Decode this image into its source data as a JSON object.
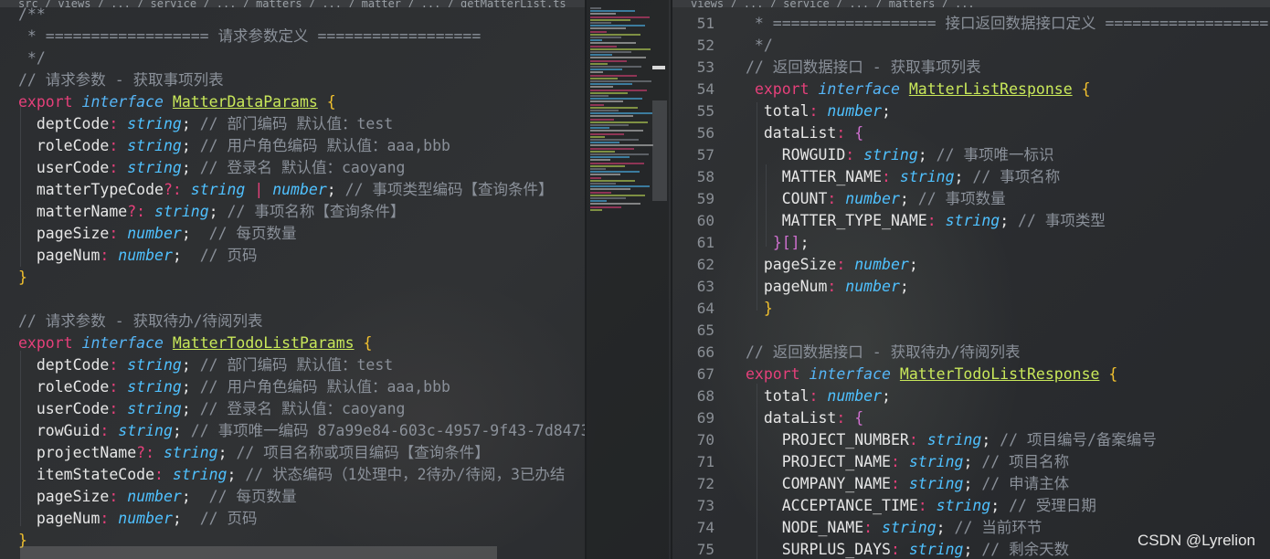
{
  "tabs": {
    "left_path": "src / views / ... / service / ... / matters / ... / matter / ... / getMatterList.ts",
    "right_path": "views / ... / service / ... / matters / ..."
  },
  "left": {
    "lines": [
      [
        [
          "cmt",
          "/**"
        ]
      ],
      [
        [
          "cmt",
          " * ================== 请求参数定义 =================="
        ]
      ],
      [
        [
          "cmt",
          " */"
        ]
      ],
      [
        [
          "cmt",
          "// 请求参数 - 获取事项列表"
        ]
      ],
      [
        [
          "kw",
          "export"
        ],
        [
          "punc",
          " "
        ],
        [
          "iface",
          "interface"
        ],
        [
          "punc",
          " "
        ],
        [
          "cls",
          "MatterDataParams"
        ],
        [
          "punc",
          " "
        ],
        [
          "brace",
          "{"
        ]
      ],
      [
        [
          "punc",
          "  "
        ],
        [
          "prop",
          "deptCode"
        ],
        [
          "opt",
          ":"
        ],
        [
          "punc",
          " "
        ],
        [
          "type",
          "string"
        ],
        [
          "punc",
          ";"
        ],
        [
          "cmt",
          " // 部门编码 默认值：test"
        ]
      ],
      [
        [
          "punc",
          "  "
        ],
        [
          "prop",
          "roleCode"
        ],
        [
          "opt",
          ":"
        ],
        [
          "punc",
          " "
        ],
        [
          "type",
          "string"
        ],
        [
          "punc",
          ";"
        ],
        [
          "cmt",
          " // 用户角色编码 默认值：aaa,bbb"
        ]
      ],
      [
        [
          "punc",
          "  "
        ],
        [
          "prop",
          "userCode"
        ],
        [
          "opt",
          ":"
        ],
        [
          "punc",
          " "
        ],
        [
          "type",
          "string"
        ],
        [
          "punc",
          ";"
        ],
        [
          "cmt",
          " // 登录名 默认值：caoyang"
        ]
      ],
      [
        [
          "punc",
          "  "
        ],
        [
          "prop",
          "matterTypeCode"
        ],
        [
          "opt",
          "?:"
        ],
        [
          "punc",
          " "
        ],
        [
          "type",
          "string"
        ],
        [
          "punc",
          " "
        ],
        [
          "kw",
          "|"
        ],
        [
          "punc",
          " "
        ],
        [
          "type",
          "number"
        ],
        [
          "punc",
          ";"
        ],
        [
          "cmt",
          " // 事项类型编码【查询条件】"
        ]
      ],
      [
        [
          "punc",
          "  "
        ],
        [
          "prop",
          "matterName"
        ],
        [
          "opt",
          "?:"
        ],
        [
          "punc",
          " "
        ],
        [
          "type",
          "string"
        ],
        [
          "punc",
          ";"
        ],
        [
          "cmt",
          " // 事项名称【查询条件】"
        ]
      ],
      [
        [
          "punc",
          "  "
        ],
        [
          "prop",
          "pageSize"
        ],
        [
          "opt",
          ":"
        ],
        [
          "punc",
          " "
        ],
        [
          "type",
          "number"
        ],
        [
          "punc",
          ";"
        ],
        [
          "cmt",
          "  // 每页数量"
        ]
      ],
      [
        [
          "punc",
          "  "
        ],
        [
          "prop",
          "pageNum"
        ],
        [
          "opt",
          ":"
        ],
        [
          "punc",
          " "
        ],
        [
          "type",
          "number"
        ],
        [
          "punc",
          ";"
        ],
        [
          "cmt",
          "  // 页码"
        ]
      ],
      [
        [
          "brace",
          "}"
        ]
      ],
      [],
      [
        [
          "cmt",
          "// 请求参数 - 获取待办/待阅列表"
        ]
      ],
      [
        [
          "kw",
          "export"
        ],
        [
          "punc",
          " "
        ],
        [
          "iface",
          "interface"
        ],
        [
          "punc",
          " "
        ],
        [
          "cls",
          "MatterTodoListParams"
        ],
        [
          "punc",
          " "
        ],
        [
          "brace",
          "{"
        ]
      ],
      [
        [
          "punc",
          "  "
        ],
        [
          "prop",
          "deptCode"
        ],
        [
          "opt",
          ":"
        ],
        [
          "punc",
          " "
        ],
        [
          "type",
          "string"
        ],
        [
          "punc",
          ";"
        ],
        [
          "cmt",
          " // 部门编码 默认值：test"
        ]
      ],
      [
        [
          "punc",
          "  "
        ],
        [
          "prop",
          "roleCode"
        ],
        [
          "opt",
          ":"
        ],
        [
          "punc",
          " "
        ],
        [
          "type",
          "string"
        ],
        [
          "punc",
          ";"
        ],
        [
          "cmt",
          " // 用户角色编码 默认值：aaa,bbb"
        ]
      ],
      [
        [
          "punc",
          "  "
        ],
        [
          "prop",
          "userCode"
        ],
        [
          "opt",
          ":"
        ],
        [
          "punc",
          " "
        ],
        [
          "type",
          "string"
        ],
        [
          "punc",
          ";"
        ],
        [
          "cmt",
          " // 登录名 默认值：caoyang"
        ]
      ],
      [
        [
          "punc",
          "  "
        ],
        [
          "prop",
          "rowGuid"
        ],
        [
          "opt",
          ":"
        ],
        [
          "punc",
          " "
        ],
        [
          "type",
          "string"
        ],
        [
          "punc",
          ";"
        ],
        [
          "cmt",
          " // 事项唯一编码 87a99e84-603c-4957-9f43-7d8473"
        ]
      ],
      [
        [
          "punc",
          "  "
        ],
        [
          "prop",
          "projectName"
        ],
        [
          "opt",
          "?:"
        ],
        [
          "punc",
          " "
        ],
        [
          "type",
          "string"
        ],
        [
          "punc",
          ";"
        ],
        [
          "cmt",
          " // 项目名称或项目编码【查询条件】"
        ]
      ],
      [
        [
          "punc",
          "  "
        ],
        [
          "prop",
          "itemStateCode"
        ],
        [
          "opt",
          ":"
        ],
        [
          "punc",
          " "
        ],
        [
          "type",
          "string"
        ],
        [
          "punc",
          ";"
        ],
        [
          "cmt",
          " // 状态编码（1处理中，2待办/待阅，3已办结"
        ]
      ],
      [
        [
          "punc",
          "  "
        ],
        [
          "prop",
          "pageSize"
        ],
        [
          "opt",
          ":"
        ],
        [
          "punc",
          " "
        ],
        [
          "type",
          "number"
        ],
        [
          "punc",
          ";"
        ],
        [
          "cmt",
          "  // 每页数量"
        ]
      ],
      [
        [
          "punc",
          "  "
        ],
        [
          "prop",
          "pageNum"
        ],
        [
          "opt",
          ":"
        ],
        [
          "punc",
          " "
        ],
        [
          "type",
          "number"
        ],
        [
          "punc",
          ";"
        ],
        [
          "cmt",
          "  // 页码"
        ]
      ],
      [
        [
          "brace",
          "}"
        ]
      ]
    ]
  },
  "right": {
    "numbers": [
      "51",
      "52",
      "53",
      "54",
      "55",
      "56",
      "57",
      "58",
      "59",
      "60",
      "61",
      "62",
      "63",
      "64",
      "65",
      "66",
      "67",
      "68",
      "69",
      "70",
      "71",
      "72",
      "73",
      "74",
      "75"
    ],
    "lines": [
      [
        [
          "cmt",
          " * ================== 接口返回数据接口定义 =================="
        ]
      ],
      [
        [
          "cmt",
          " */"
        ]
      ],
      [
        [
          "cmt",
          "// 返回数据接口 - 获取事项列表"
        ]
      ],
      [
        [
          "punc",
          " "
        ],
        [
          "kw",
          "export"
        ],
        [
          "punc",
          " "
        ],
        [
          "iface",
          "interface"
        ],
        [
          "punc",
          " "
        ],
        [
          "cls",
          "MatterListResponse"
        ],
        [
          "punc",
          " "
        ],
        [
          "brace",
          "{"
        ]
      ],
      [
        [
          "punc",
          "  "
        ],
        [
          "prop",
          "total"
        ],
        [
          "opt",
          ":"
        ],
        [
          "punc",
          " "
        ],
        [
          "type",
          "number"
        ],
        [
          "punc",
          ";"
        ]
      ],
      [
        [
          "punc",
          "  "
        ],
        [
          "prop",
          "dataList"
        ],
        [
          "opt",
          ":"
        ],
        [
          "punc",
          " "
        ],
        [
          "brace2",
          "{"
        ]
      ],
      [
        [
          "punc",
          "    "
        ],
        [
          "prop",
          "ROWGUID"
        ],
        [
          "opt",
          ":"
        ],
        [
          "punc",
          " "
        ],
        [
          "type",
          "string"
        ],
        [
          "punc",
          ";"
        ],
        [
          "cmt",
          " // 事项唯一标识"
        ]
      ],
      [
        [
          "punc",
          "    "
        ],
        [
          "prop",
          "MATTER_NAME"
        ],
        [
          "opt",
          ":"
        ],
        [
          "punc",
          " "
        ],
        [
          "type",
          "string"
        ],
        [
          "punc",
          ";"
        ],
        [
          "cmt",
          " // 事项名称"
        ]
      ],
      [
        [
          "punc",
          "    "
        ],
        [
          "prop",
          "COUNT"
        ],
        [
          "opt",
          ":"
        ],
        [
          "punc",
          " "
        ],
        [
          "type",
          "number"
        ],
        [
          "punc",
          ";"
        ],
        [
          "cmt",
          " // 事项数量"
        ]
      ],
      [
        [
          "punc",
          "    "
        ],
        [
          "prop",
          "MATTER_TYPE_NAME"
        ],
        [
          "opt",
          ":"
        ],
        [
          "punc",
          " "
        ],
        [
          "type",
          "string"
        ],
        [
          "punc",
          ";"
        ],
        [
          "cmt",
          " // 事项类型"
        ]
      ],
      [
        [
          "punc",
          "   "
        ],
        [
          "brace2",
          "}[]"
        ],
        [
          "punc",
          ";"
        ]
      ],
      [
        [
          "punc",
          "  "
        ],
        [
          "prop",
          "pageSize"
        ],
        [
          "opt",
          ":"
        ],
        [
          "punc",
          " "
        ],
        [
          "type",
          "number"
        ],
        [
          "punc",
          ";"
        ]
      ],
      [
        [
          "punc",
          "  "
        ],
        [
          "prop",
          "pageNum"
        ],
        [
          "opt",
          ":"
        ],
        [
          "punc",
          " "
        ],
        [
          "type",
          "number"
        ],
        [
          "punc",
          ";"
        ]
      ],
      [
        [
          "punc",
          "  "
        ],
        [
          "brace",
          "}"
        ]
      ],
      [],
      [
        [
          "cmt",
          "// 返回数据接口 - 获取待办/待阅列表"
        ]
      ],
      [
        [
          "kw",
          "export"
        ],
        [
          "punc",
          " "
        ],
        [
          "iface",
          "interface"
        ],
        [
          "punc",
          " "
        ],
        [
          "cls",
          "MatterTodoListResponse"
        ],
        [
          "punc",
          " "
        ],
        [
          "brace",
          "{"
        ]
      ],
      [
        [
          "punc",
          "  "
        ],
        [
          "prop",
          "total"
        ],
        [
          "opt",
          ":"
        ],
        [
          "punc",
          " "
        ],
        [
          "type",
          "number"
        ],
        [
          "punc",
          ";"
        ]
      ],
      [
        [
          "punc",
          "  "
        ],
        [
          "prop",
          "dataList"
        ],
        [
          "opt",
          ":"
        ],
        [
          "punc",
          " "
        ],
        [
          "brace2",
          "{"
        ]
      ],
      [
        [
          "punc",
          "    "
        ],
        [
          "prop",
          "PROJECT_NUMBER"
        ],
        [
          "opt",
          ":"
        ],
        [
          "punc",
          " "
        ],
        [
          "type",
          "string"
        ],
        [
          "punc",
          ";"
        ],
        [
          "cmt",
          " // 项目编号/备案编号"
        ]
      ],
      [
        [
          "punc",
          "    "
        ],
        [
          "prop",
          "PROJECT_NAME"
        ],
        [
          "opt",
          ":"
        ],
        [
          "punc",
          " "
        ],
        [
          "type",
          "string"
        ],
        [
          "punc",
          ";"
        ],
        [
          "cmt",
          " // 项目名称"
        ]
      ],
      [
        [
          "punc",
          "    "
        ],
        [
          "prop",
          "COMPANY_NAME"
        ],
        [
          "opt",
          ":"
        ],
        [
          "punc",
          " "
        ],
        [
          "type",
          "string"
        ],
        [
          "punc",
          ";"
        ],
        [
          "cmt",
          " // 申请主体"
        ]
      ],
      [
        [
          "punc",
          "    "
        ],
        [
          "prop",
          "ACCEPTANCE_TIME"
        ],
        [
          "opt",
          ":"
        ],
        [
          "punc",
          " "
        ],
        [
          "type",
          "string"
        ],
        [
          "punc",
          ";"
        ],
        [
          "cmt",
          " // 受理日期"
        ]
      ],
      [
        [
          "punc",
          "    "
        ],
        [
          "prop",
          "NODE_NAME"
        ],
        [
          "opt",
          ":"
        ],
        [
          "punc",
          " "
        ],
        [
          "type",
          "string"
        ],
        [
          "punc",
          ";"
        ],
        [
          "cmt",
          " // 当前环节"
        ]
      ],
      [
        [
          "punc",
          "    "
        ],
        [
          "prop",
          "SURPLUS_DAYS"
        ],
        [
          "opt",
          ":"
        ],
        [
          "punc",
          " "
        ],
        [
          "type",
          "string"
        ],
        [
          "punc",
          ";"
        ],
        [
          "cmt",
          " // 剩余天数"
        ]
      ]
    ]
  },
  "watermark": "CSDN @Lyrelion",
  "colors": {
    "keyword": "#e5407a",
    "interface_keyword": "#56b6f7",
    "type": "#4fc1ff",
    "class_name": "#c9e85a",
    "comment": "#8a9099",
    "brace": "#f2c12e",
    "object_brace": "#d070d0",
    "background": "#2b2d30"
  }
}
